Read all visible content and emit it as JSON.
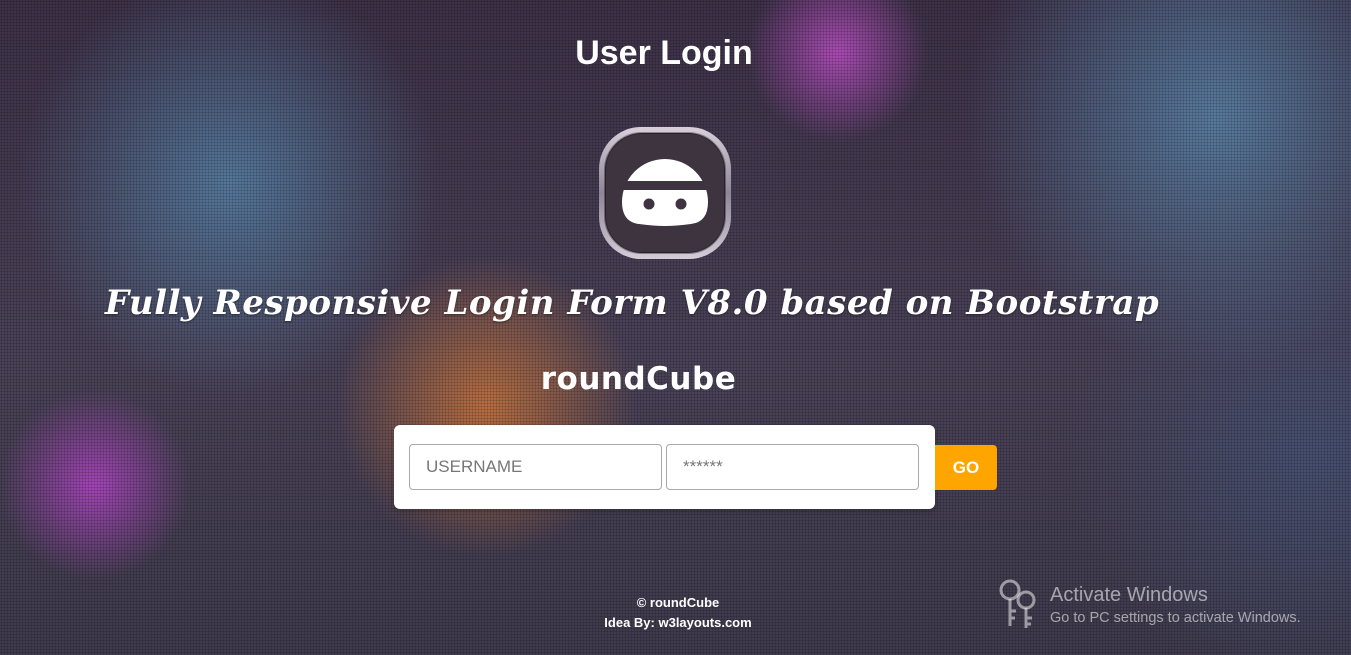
{
  "header": {
    "title": "User Login"
  },
  "banner": {
    "avatar_icon": "user-avatar-icon",
    "subtitle": "Fully Responsive Login Form V8.0 based on Bootstrap",
    "brand": "roundCube"
  },
  "login_form": {
    "username_placeholder": "USERNAME",
    "password_placeholder": "******",
    "submit_label": "GO"
  },
  "footer": {
    "copyright": "© roundCube",
    "credit": "Idea By: w3layouts.com"
  },
  "watermark": {
    "icon": "keys-icon",
    "title": "Activate Windows",
    "subtitle": "Go to PC settings to activate Windows."
  },
  "colors": {
    "accent": "#ffa500",
    "card": "#ffffff",
    "text": "#ffffff"
  }
}
